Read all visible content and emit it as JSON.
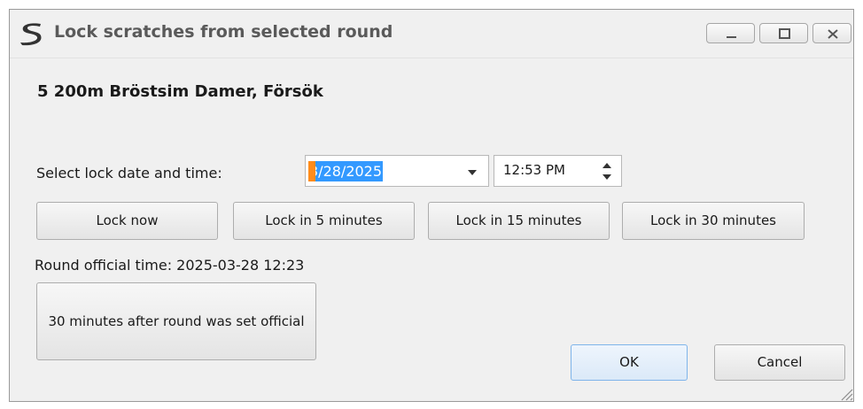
{
  "window": {
    "title": "Lock scratches from selected round"
  },
  "round": {
    "name": "5 200m Bröstsim Damer, Försök"
  },
  "lock": {
    "label": "Select lock date and time:",
    "date": "3/28/2025",
    "time": "12:53 PM"
  },
  "quick_buttons": {
    "lock_now": "Lock now",
    "lock_5": "Lock in 5 minutes",
    "lock_15": "Lock in 15 minutes",
    "lock_30": "Lock in 30 minutes"
  },
  "official": {
    "time_text": "Round official time: 2025-03-28 12:23",
    "after_button": "30 minutes after round was set official"
  },
  "dialog": {
    "ok": "OK",
    "cancel": "Cancel"
  },
  "colors": {
    "selection": "#3399ff",
    "caret": "#ff8c1a",
    "ok_border": "#7eb4ea"
  }
}
